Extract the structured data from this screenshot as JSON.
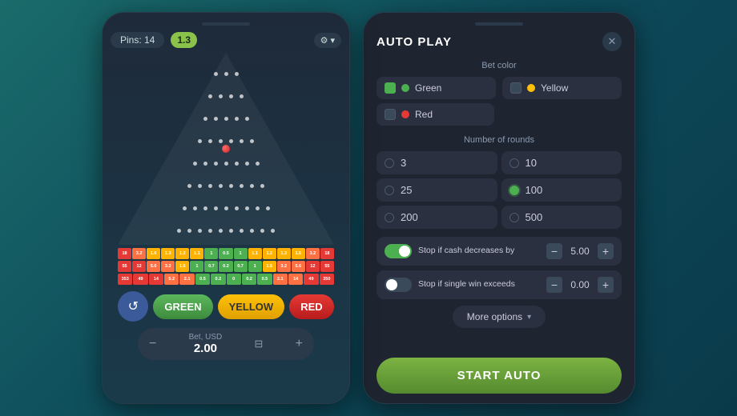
{
  "left_phone": {
    "header": {
      "pins_label": "Pins: 14",
      "multiplier": "1.3",
      "settings_icon": "⚙",
      "chevron": "▾"
    },
    "bet_buttons": {
      "refresh_icon": "↺",
      "green_label": "GREEN",
      "yellow_label": "YELLOW",
      "red_label": "RED"
    },
    "bet_amount": {
      "label": "Bet, USD",
      "value": "2.00",
      "minus_icon": "−",
      "stack_icon": "⊟",
      "plus_icon": "+"
    },
    "score_rows": [
      [
        "18",
        "3.2",
        "1.6",
        "1.3",
        "1.2",
        "1.1",
        "1",
        "0.5",
        "1",
        "1.1",
        "1.2",
        "1.3",
        "1.6",
        "3.2",
        "18"
      ],
      [
        "55",
        "12",
        "5.6",
        "3.2",
        "1.6",
        "1",
        "0.7",
        "0.2",
        "0.7",
        "1",
        "1.6",
        "3.2",
        "5.6",
        "12",
        "55"
      ],
      [
        "353",
        "49",
        "14",
        "5.2",
        "2.1",
        "0.5",
        "0.2",
        "0",
        "0.2",
        "0.5",
        "2.1",
        "14",
        "49",
        "350"
      ]
    ]
  },
  "right_panel": {
    "title": "AUTO PLAY",
    "close_icon": "✕",
    "bet_color": {
      "label": "Bet color",
      "options": [
        {
          "id": "green",
          "label": "Green",
          "color": "#4caf50",
          "checked": true
        },
        {
          "id": "yellow",
          "label": "Yellow",
          "color": "#ffc107",
          "checked": false
        },
        {
          "id": "red",
          "label": "Red",
          "color": "#e53935",
          "checked": false
        }
      ]
    },
    "rounds": {
      "label": "Number of rounds",
      "options": [
        {
          "value": "3",
          "selected": false
        },
        {
          "value": "10",
          "selected": false
        },
        {
          "value": "25",
          "selected": false
        },
        {
          "value": "100",
          "selected": true
        },
        {
          "value": "200",
          "selected": false
        },
        {
          "value": "500",
          "selected": false
        }
      ]
    },
    "stop_conditions": [
      {
        "id": "cash_decreases",
        "enabled": true,
        "label": "Stop if cash decreases by",
        "value": "5.00"
      },
      {
        "id": "single_win",
        "enabled": false,
        "label": "Stop if single win exceeds",
        "value": "0.00"
      }
    ],
    "more_options": {
      "label": "More options",
      "chevron": "▾"
    },
    "start_button": {
      "label": "START AUTO"
    }
  }
}
